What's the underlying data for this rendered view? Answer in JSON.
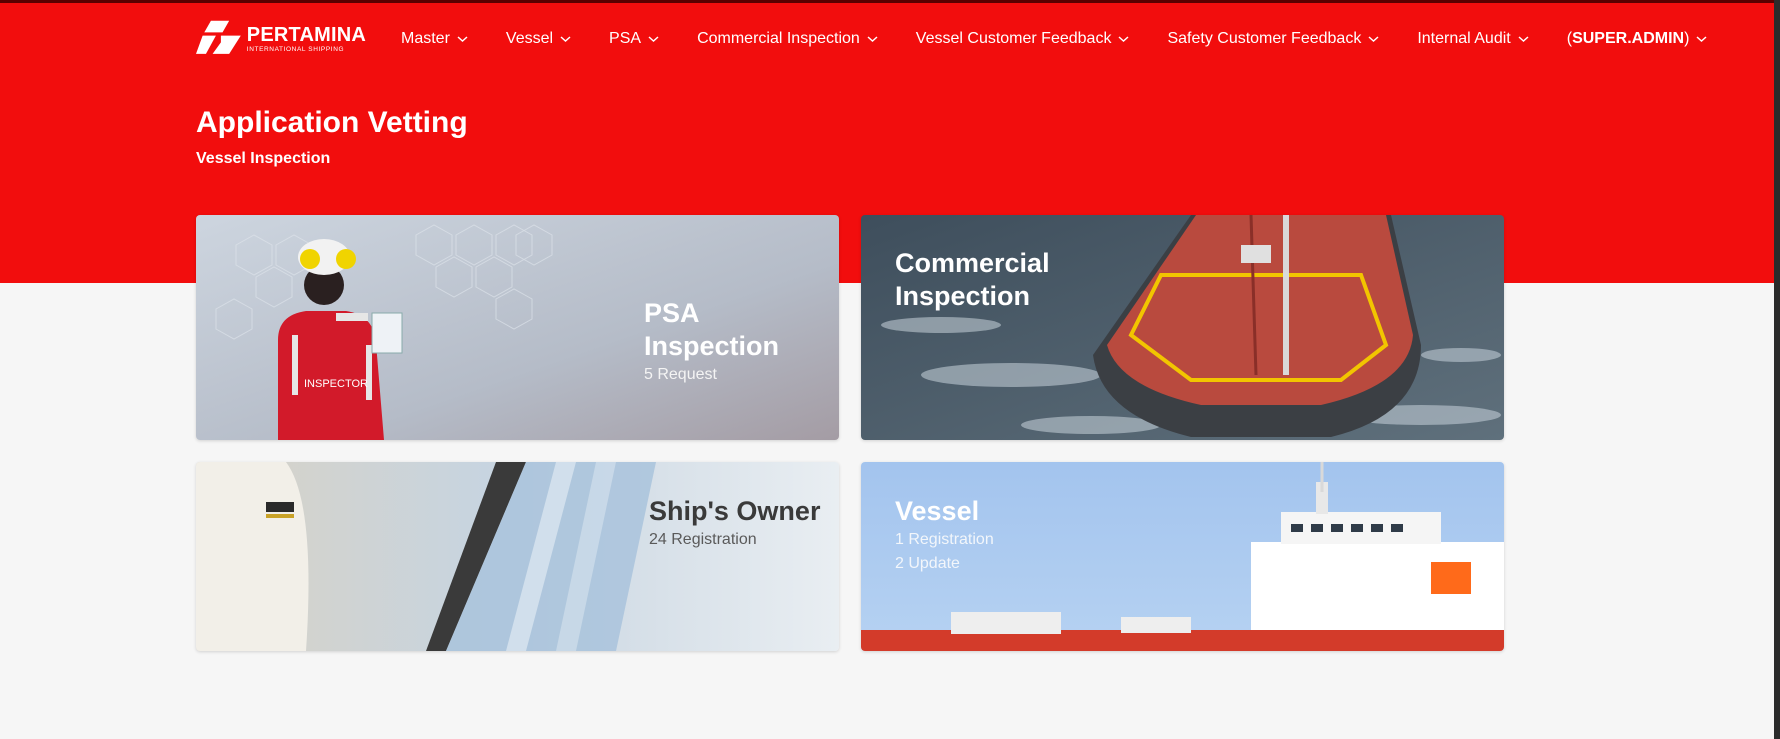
{
  "brand": {
    "name": "PERTAMINA",
    "tagline": "INTERNATIONAL SHIPPING"
  },
  "nav": {
    "items": [
      {
        "label": "Master"
      },
      {
        "label": "Vessel"
      },
      {
        "label": "PSA"
      },
      {
        "label": "Commercial Inspection"
      },
      {
        "label": "Vessel Customer Feedback"
      },
      {
        "label": "Safety Customer Feedback"
      },
      {
        "label": "Internal Audit"
      }
    ],
    "user": {
      "open": "(",
      "name": "SUPER.ADMIN",
      "close": ")"
    }
  },
  "page": {
    "title": "Application Vetting",
    "subtitle": "Vessel Inspection"
  },
  "cards": {
    "psa": {
      "title_line1": "PSA",
      "title_line2": "Inspection",
      "lines": [
        "5 Request"
      ]
    },
    "commercial": {
      "title_line1": "Commercial",
      "title_line2": "Inspection"
    },
    "owner": {
      "title": "Ship's Owner",
      "lines": [
        "24 Registration"
      ]
    },
    "vessel": {
      "title": "Vessel",
      "lines": [
        "1 Registration",
        "2 Update"
      ]
    }
  },
  "colors": {
    "header_red": "#f20d0d",
    "page_bg": "#f6f6f6",
    "white": "#ffffff"
  },
  "icons": {
    "chevron": "chevron-down-icon",
    "logo": "pertamina-logo-icon"
  }
}
